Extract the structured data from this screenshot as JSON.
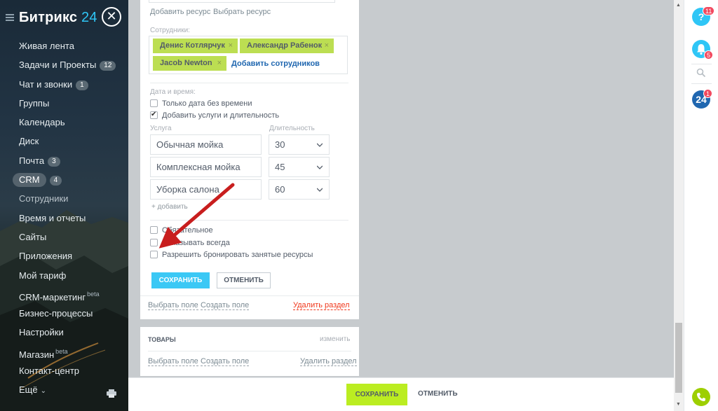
{
  "sidebar": {
    "logo_text": "Битрикс",
    "logo_num": "24",
    "items": [
      {
        "label": "Живая лента",
        "badge": ""
      },
      {
        "label": "Задачи и Проекты",
        "badge": "12"
      },
      {
        "label": "Чат и звонки",
        "badge": "1"
      },
      {
        "label": "Группы",
        "badge": ""
      },
      {
        "label": "Календарь",
        "badge": ""
      },
      {
        "label": "Диск",
        "badge": ""
      },
      {
        "label": "Почта",
        "badge": "3"
      },
      {
        "label": "CRM",
        "badge": "4"
      },
      {
        "label": "Сотрудники",
        "badge": ""
      },
      {
        "label": "Время и отчеты",
        "badge": ""
      },
      {
        "label": "Сайты",
        "badge": ""
      },
      {
        "label": "Приложения",
        "badge": ""
      },
      {
        "label": "Мой тариф",
        "badge": ""
      },
      {
        "label": "CRM-маркетинг",
        "beta": "beta"
      },
      {
        "label": "Бизнес-процессы",
        "badge": ""
      },
      {
        "label": "Настройки",
        "badge": ""
      },
      {
        "label": "Магазин",
        "beta": "beta"
      },
      {
        "label": "Контакт-центр",
        "badge": ""
      },
      {
        "label": "Ещё",
        "chevron": "⌄"
      }
    ]
  },
  "form": {
    "add_resource": "Добавить ресурс",
    "choose_resource": "Выбрать ресурс",
    "employees_label": "Сотрудники:",
    "employees": [
      "Денис Котлярчук",
      "Александр Рабенок",
      "Jacob Newton"
    ],
    "tag_remove": "×",
    "add_employees": "Добавить сотрудников",
    "datetime_label": "Дата и время:",
    "date_only": "Только дата без времени",
    "add_services": "Добавить услуги и длительность",
    "service_col": "Услуга",
    "duration_col": "Длительность",
    "services": [
      {
        "name": "Обычная мойка",
        "duration": "30"
      },
      {
        "name": "Комплексная мойка",
        "duration": "45"
      },
      {
        "name": "Уборка салона",
        "duration": "60"
      }
    ],
    "add": "+ добавить",
    "required": "Обязательное",
    "show_always": "Показывать всегда",
    "allow_busy": "Разрешить бронировать занятые ресурсы",
    "save": "СОХРАНИТЬ",
    "cancel": "ОТМЕНИТЬ",
    "choose_field": "Выбрать поле",
    "create_field": "Создать поле",
    "delete_section": "Удалить раздел"
  },
  "goods": {
    "title": "ТОВАРЫ",
    "edit": "изменить",
    "choose_field": "Выбрать поле",
    "create_field": "Создать поле",
    "delete_section": "Удалить раздел"
  },
  "bottom": {
    "save": "СОХРАНИТЬ",
    "cancel": "ОТМЕНИТЬ"
  },
  "rightbar": {
    "help_badge": "11",
    "notify_badge": "5",
    "b24_badge": "1",
    "b24_label": "24",
    "help_label": "?"
  },
  "colors": {
    "accent_blue": "#3bc8f5",
    "accent_green": "#bbed21",
    "tag_green": "#bcde52",
    "arrow_red": "#c81e1e",
    "delete_red": "#f0371b"
  }
}
